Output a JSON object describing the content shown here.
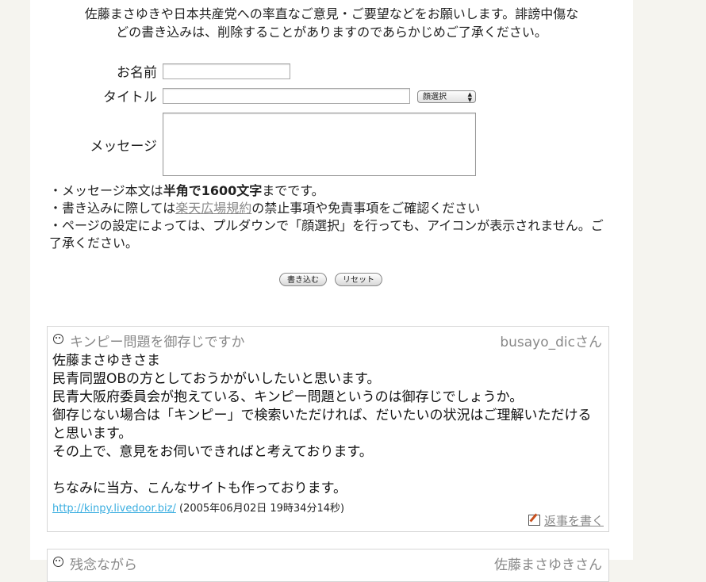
{
  "intro": {
    "line1": "佐藤まさゆきや日本共産党への率直なご意見・ご要望などをお願いします。誹謗中傷な",
    "line2": "どの書き込みは、削除することがありますのであらかじめご了承ください。"
  },
  "form": {
    "name_label": "お名前",
    "name_value": "",
    "title_label": "タイトル",
    "title_value": "",
    "face_select": "顔選択",
    "message_label": "メッセージ",
    "message_value": ""
  },
  "notes": {
    "n1_pre": "・メッセージ本文は",
    "n1_bold": "半角で1600文字",
    "n1_post": "までです。",
    "n2_pre": "・書き込みに際しては",
    "n2_link": "楽天広場規約",
    "n2_post": "の禁止事項や免責事項をご確認ください",
    "n3": "・ページの設定によっては、プルダウンで「顔選択」を行っても、アイコンが表示されません。ご了承ください。"
  },
  "buttons": {
    "submit": "書き込む",
    "reset": "リセット"
  },
  "posts": [
    {
      "title": "キンピー問題を御存じですか",
      "author": "busayo_dicさん",
      "body": [
        "佐藤まさゆきさま",
        "民青同盟OBの方としておうかがいしたいと思います。",
        "民青大阪府委員会が抱えている、キンピー問題というのは御存じでしょうか。",
        "御存じない場合は「キンピー」で検索いただければ、だいたいの状況はご理解いただけると思います。",
        "その上で、意見をお伺いできればと考えております。",
        "",
        "ちなみに当方、こんなサイトも作っております。"
      ],
      "link": "http://kinpy.livedoor.biz/",
      "timestamp": "(2005年06月02日 19時34分14秒)",
      "reply": "返事を書く"
    },
    {
      "title": "残念ながら",
      "author": "佐藤まさゆきさん"
    }
  ]
}
